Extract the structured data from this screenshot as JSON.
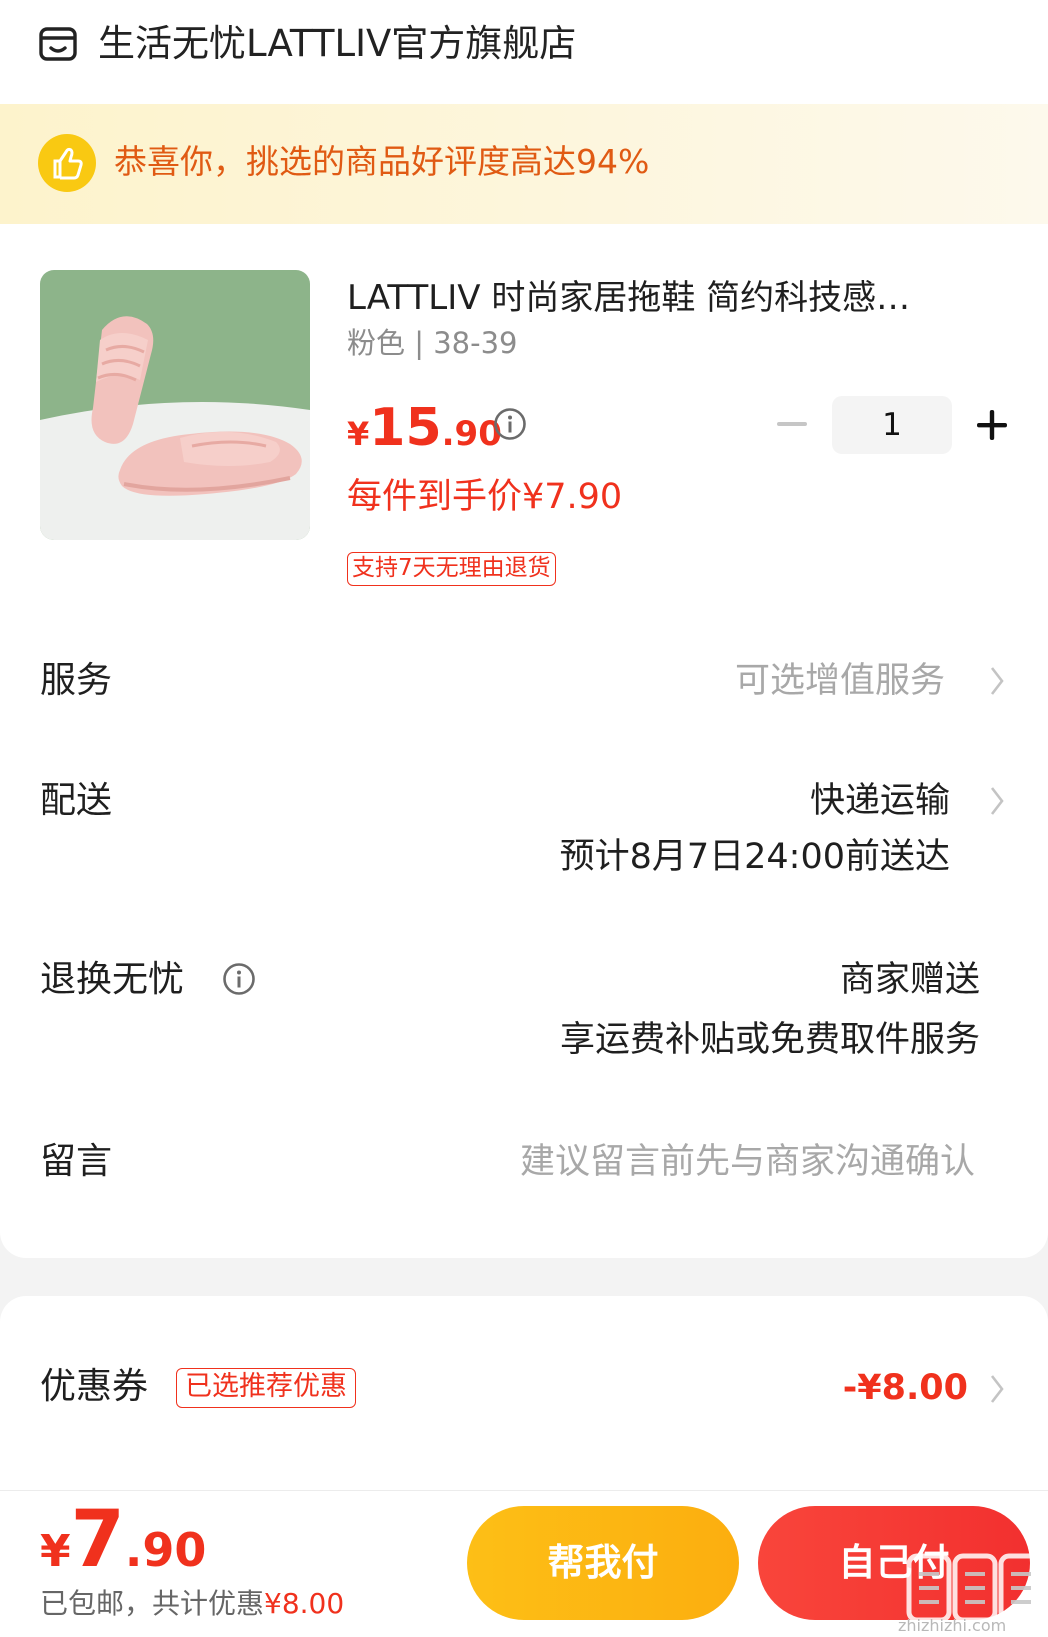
{
  "header": {
    "store_name": "生活无忧LATTLIV官方旗舰店",
    "icon": "store-icon"
  },
  "banner": {
    "text": "恭喜你，挑选的商品好评度高达94%",
    "icon": "thumbs-up-icon"
  },
  "product": {
    "title": "LATTLIV 时尚家居拖鞋 简约科技感…",
    "spec": "粉色 | 38-39",
    "price_yen": "¥",
    "price_int": "15",
    "price_dec": ".90",
    "final_price": "每件到手价¥7.90",
    "return_tag": "支持7天无理由退货",
    "quantity": "1",
    "image_colors": {
      "background": "#8db48a",
      "slipper": "#f2c2bd"
    }
  },
  "rows": {
    "service": {
      "label": "服务",
      "value": "可选增值服务"
    },
    "delivery": {
      "label": "配送",
      "value": "快递运输",
      "sub": "预计8月7日24:00前送达"
    },
    "returns": {
      "label": "退换无忧",
      "value": "商家赠送",
      "sub": "享运费补贴或免费取件服务"
    },
    "message": {
      "label": "留言",
      "placeholder": "建议留言前先与商家沟通确认"
    }
  },
  "coupon": {
    "label": "优惠券",
    "badge": "已选推荐优惠",
    "value": "-¥8.00"
  },
  "bottom": {
    "total_yen": "¥",
    "total_int": "7",
    "total_dec": ".90",
    "note_prefix": "已包邮，共计优惠",
    "note_amount": "¥8.00",
    "help_pay": "帮我付",
    "self_pay": "自己付"
  },
  "watermark": {
    "glyph": "值",
    "domain": "zhizhizhi.com"
  },
  "colors": {
    "accent_red": "#f0311d",
    "banner_orange": "#e05a13",
    "help_yellow": "#fdbf16",
    "self_red": "#f2302f"
  }
}
